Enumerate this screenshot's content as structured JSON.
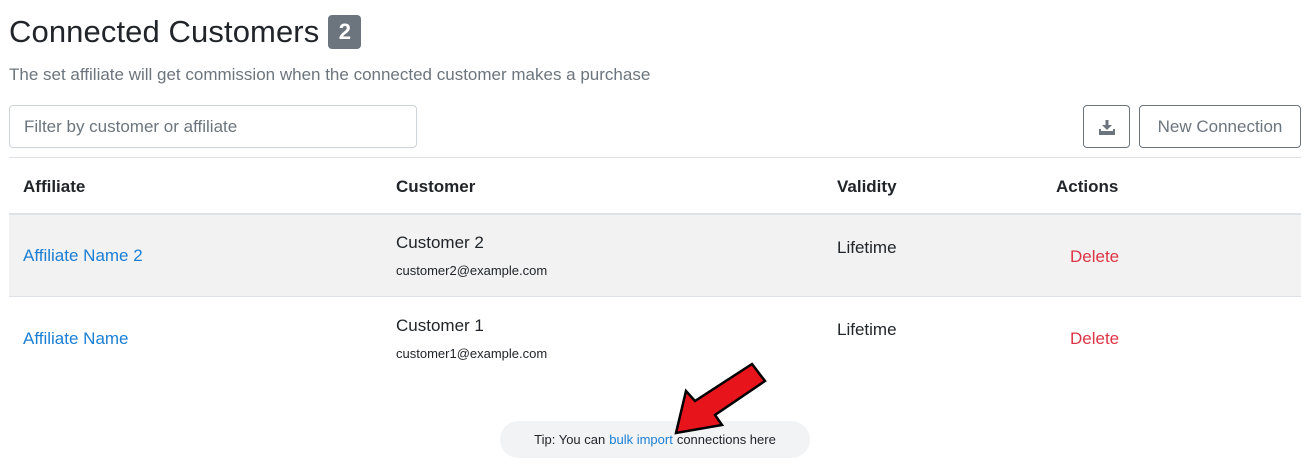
{
  "header": {
    "title": "Connected Customers",
    "count": "2",
    "subtitle": "The set affiliate will get commission when the connected customer makes a purchase"
  },
  "toolbar": {
    "filter_placeholder": "Filter by customer or affiliate",
    "filter_value": "",
    "download_icon": "download-icon",
    "new_connection_label": "New Connection"
  },
  "table": {
    "columns": [
      "Affiliate",
      "Customer",
      "Validity",
      "Actions"
    ],
    "rows": [
      {
        "affiliate": "Affiliate Name 2",
        "customer_name": "Customer 2",
        "customer_email": "customer2@example.com",
        "validity": "Lifetime",
        "action": "Delete"
      },
      {
        "affiliate": "Affiliate Name",
        "customer_name": "Customer 1",
        "customer_email": "customer1@example.com",
        "validity": "Lifetime",
        "action": "Delete"
      }
    ]
  },
  "tip": {
    "prefix": "Tip: You can",
    "link": "bulk import",
    "suffix": "connections here"
  },
  "colors": {
    "link": "#1a7fd4",
    "delete": "#dc3545",
    "badge": "#6c757d",
    "stripe": "#f2f2f2",
    "annotation_arrow": "#e8141c"
  }
}
